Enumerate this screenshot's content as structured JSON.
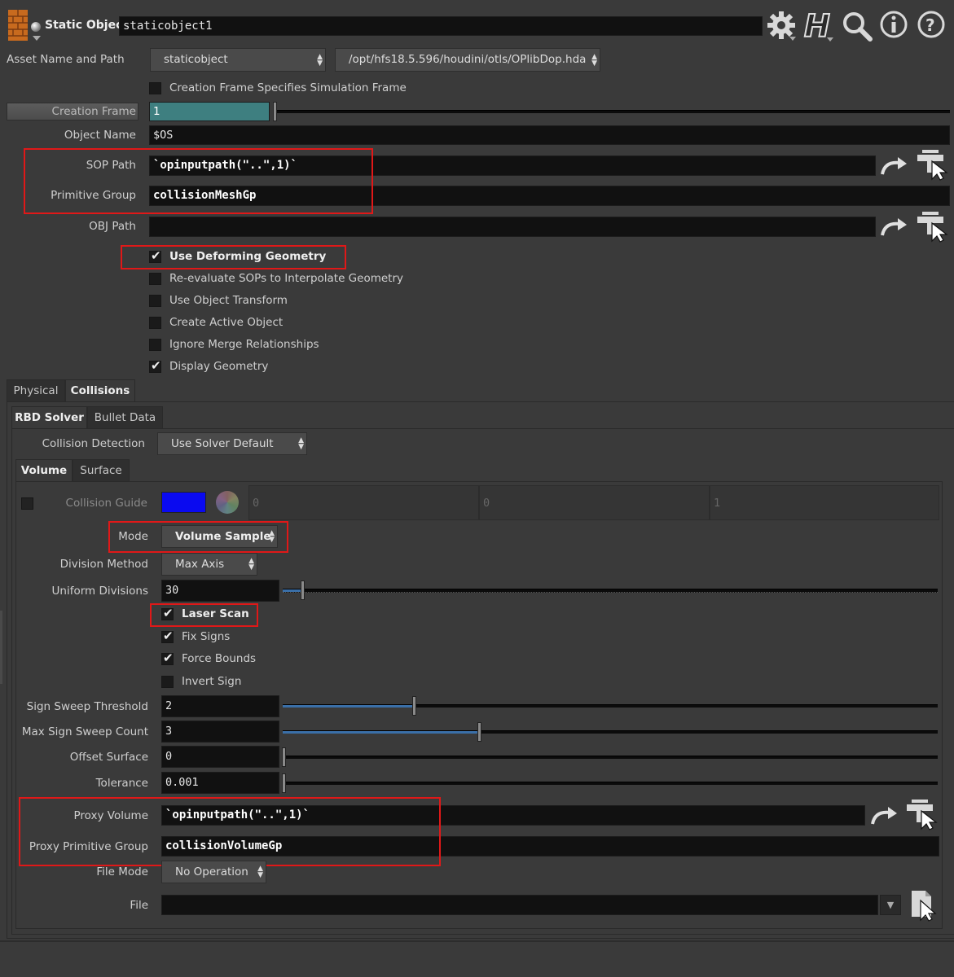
{
  "header": {
    "node_type": "Static Object",
    "node_name": "staticobject1"
  },
  "asset": {
    "label": "Asset Name and Path",
    "name": "staticobject",
    "path": "/opt/hfs18.5.596/houdini/otls/OPlibDop.hda"
  },
  "params": {
    "creation_frame_specifies": "Creation Frame Specifies Simulation Frame",
    "creation_frame_label": "Creation Frame",
    "creation_frame_value": "1",
    "object_name_label": "Object Name",
    "object_name_value": "$OS",
    "sop_path_label": "SOP Path",
    "sop_path_value": "`opinputpath(\"..\",1)`",
    "primitive_group_label": "Primitive Group",
    "primitive_group_value": "collisionMeshGp",
    "obj_path_label": "OBJ Path",
    "obj_path_value": ""
  },
  "toggles": [
    {
      "label": "Use Deforming Geometry",
      "checked": true
    },
    {
      "label": "Re-evaluate SOPs to Interpolate Geometry",
      "checked": false
    },
    {
      "label": "Use Object Transform",
      "checked": false
    },
    {
      "label": "Create Active Object",
      "checked": false
    },
    {
      "label": "Ignore Merge Relationships",
      "checked": false
    },
    {
      "label": "Display Geometry",
      "checked": true
    }
  ],
  "tabs_main": [
    "Physical",
    "Collisions"
  ],
  "tabs_sub": [
    "RBD Solver",
    "Bullet Data"
  ],
  "collision_detection": {
    "label": "Collision Detection",
    "value": "Use Solver Default"
  },
  "tabs_volume": [
    "Volume",
    "Surface"
  ],
  "volume": {
    "collision_guide_label": "Collision Guide",
    "guide_color": "#0a0af0",
    "guide_values": [
      "0",
      "0",
      "1"
    ],
    "mode_label": "Mode",
    "mode_value": "Volume Sample",
    "division_method_label": "Division Method",
    "division_method_value": "Max Axis",
    "uniform_divisions_label": "Uniform Divisions",
    "uniform_divisions_value": "30",
    "checks": [
      {
        "label": "Laser Scan",
        "checked": true
      },
      {
        "label": "Fix Signs",
        "checked": true
      },
      {
        "label": "Force Bounds",
        "checked": true
      },
      {
        "label": "Invert Sign",
        "checked": false
      }
    ],
    "sign_sweep_threshold_label": "Sign Sweep Threshold",
    "sign_sweep_threshold_value": "2",
    "max_sign_sweep_count_label": "Max Sign Sweep Count",
    "max_sign_sweep_count_value": "3",
    "offset_surface_label": "Offset Surface",
    "offset_surface_value": "0",
    "tolerance_label": "Tolerance",
    "tolerance_value": "0.001",
    "proxy_volume_label": "Proxy Volume",
    "proxy_volume_value": "`opinputpath(\"..\",1)`",
    "proxy_primitive_group_label": "Proxy Primitive Group",
    "proxy_primitive_group_value": "collisionVolumeGp",
    "file_mode_label": "File Mode",
    "file_mode_value": "No Operation",
    "file_label": "File",
    "file_value": ""
  },
  "colors": {
    "highlight": "#e01818",
    "slider_fill": "#3a6fa8",
    "creation_frame_field": "#3e7f80"
  }
}
